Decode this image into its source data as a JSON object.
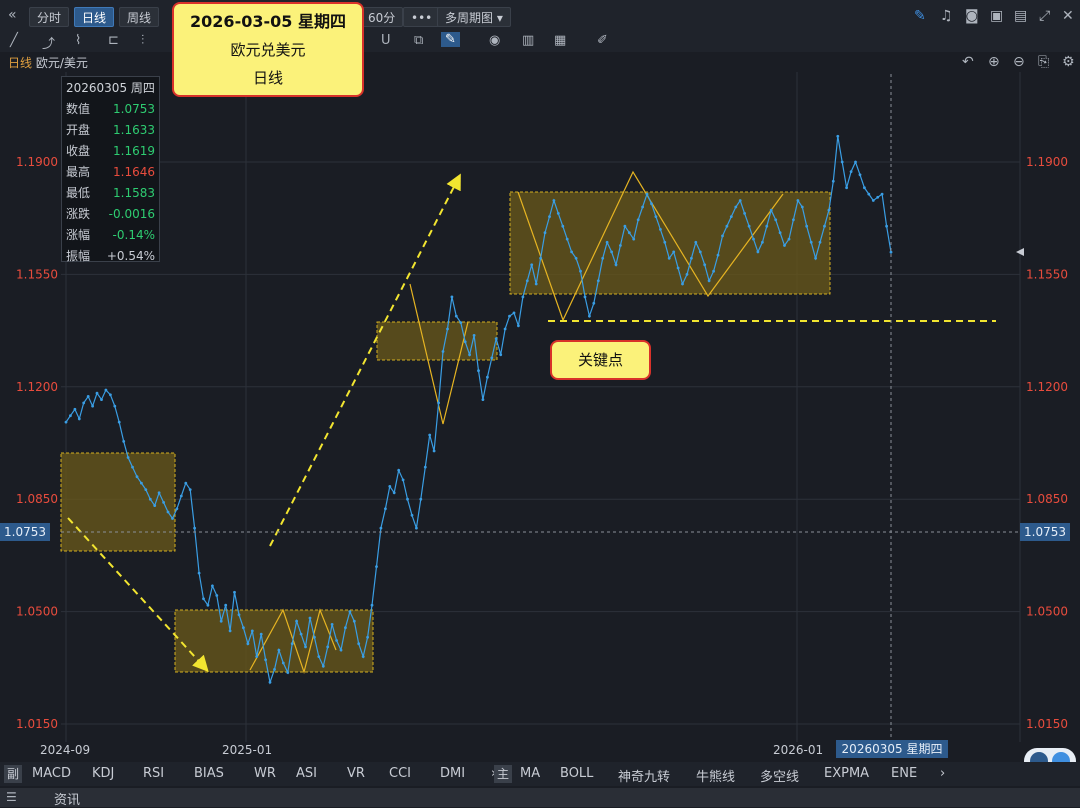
{
  "toolbar": {
    "nav_icon": "«",
    "buttons": [
      "分时",
      "日线",
      "周线"
    ],
    "active": "日线",
    "minute_button": "60分",
    "more_button": "•••",
    "multi_period": "多周期图 ▾"
  },
  "title": {
    "period": "日线",
    "instrument": "欧元/美元"
  },
  "callout_top": {
    "line1": "2026-03-05 星期四",
    "line2": "欧元兑美元",
    "line3": "日线"
  },
  "callout_key": "关键点",
  "info": {
    "header": "20260305 周四",
    "rows": [
      {
        "label": "数值",
        "value": "1.0753",
        "color": "#2ecc71"
      },
      {
        "label": "开盘",
        "value": "1.1633",
        "color": "#2ecc71"
      },
      {
        "label": "收盘",
        "value": "1.1619",
        "color": "#2ecc71"
      },
      {
        "label": "最高",
        "value": "1.1646",
        "color": "#e84c3d"
      },
      {
        "label": "最低",
        "value": "1.1583",
        "color": "#2ecc71"
      },
      {
        "label": "涨跌",
        "value": "-0.0016",
        "color": "#2ecc71"
      },
      {
        "label": "涨幅",
        "value": "-0.14%",
        "color": "#2ecc71"
      },
      {
        "label": "振幅",
        "value": "+0.54%",
        "color": "#c8ccd4"
      }
    ]
  },
  "current_price_tag": "1.0753",
  "date_tag": "20260305 星期四",
  "x_labels": [
    "2024-09",
    "2025-01",
    "2026-01"
  ],
  "bottom_indicators": [
    "副",
    "MACD",
    "KDJ",
    "RSI",
    "BIAS",
    "WR",
    "ASI",
    "VR",
    "CCI",
    "DMI",
    "›"
  ],
  "bottom_main": [
    "主",
    "MA",
    "BOLL",
    "神奇九转",
    "牛熊线",
    "多空线",
    "EXPMA",
    "ENE",
    "›"
  ],
  "info_bar": "资讯",
  "colors": {
    "line": "#3a9ee4",
    "box_fill": "#6b5a1a",
    "box_border": "#d4b020",
    "arrow": "#f2e530",
    "up": "#e84c3d",
    "down": "#2ecc71",
    "accent": "#2d5a8c"
  },
  "chart_data": {
    "type": "line",
    "title": "",
    "xlabel": "",
    "ylabel": "",
    "ylim": [
      1.015,
      1.205
    ],
    "y_ticks": [
      1.015,
      1.05,
      1.085,
      1.12,
      1.155,
      1.19
    ],
    "x_tick_labels": [
      "2024-09",
      "2025-01",
      "2026-01"
    ],
    "series": [
      {
        "values": [
          1.109,
          1.111,
          1.113,
          1.11,
          1.115,
          1.117,
          1.114,
          1.118,
          1.116,
          1.119,
          1.1175,
          1.114,
          1.109,
          1.103,
          1.098,
          1.095,
          1.092,
          1.09,
          1.088,
          1.085,
          1.083,
          1.087,
          1.084,
          1.081,
          1.079,
          1.082,
          1.086,
          1.09,
          1.088,
          1.076,
          1.062,
          1.054,
          1.052,
          1.058,
          1.055,
          1.047,
          1.052,
          1.044,
          1.056,
          1.049,
          1.045,
          1.04,
          1.044,
          1.036,
          1.043,
          1.035,
          1.028,
          1.032,
          1.038,
          1.034,
          1.031,
          1.04,
          1.047,
          1.043,
          1.039,
          1.048,
          1.042,
          1.036,
          1.033,
          1.039,
          1.046,
          1.041,
          1.038,
          1.045,
          1.05,
          1.047,
          1.04,
          1.036,
          1.042,
          1.052,
          1.064,
          1.076,
          1.082,
          1.089,
          1.087,
          1.094,
          1.091,
          1.085,
          1.08,
          1.076,
          1.085,
          1.095,
          1.105,
          1.1,
          1.115,
          1.131,
          1.138,
          1.148,
          1.142,
          1.14,
          1.134,
          1.13,
          1.136,
          1.125,
          1.116,
          1.123,
          1.129,
          1.135,
          1.13,
          1.138,
          1.142,
          1.143,
          1.139,
          1.148,
          1.153,
          1.158,
          1.152,
          1.16,
          1.168,
          1.173,
          1.178,
          1.174,
          1.17,
          1.166,
          1.162,
          1.16,
          1.156,
          1.148,
          1.142,
          1.146,
          1.153,
          1.16,
          1.165,
          1.162,
          1.158,
          1.164,
          1.17,
          1.168,
          1.166,
          1.172,
          1.176,
          1.18,
          1.177,
          1.173,
          1.169,
          1.165,
          1.16,
          1.162,
          1.157,
          1.152,
          1.155,
          1.16,
          1.165,
          1.162,
          1.158,
          1.153,
          1.156,
          1.161,
          1.167,
          1.17,
          1.173,
          1.176,
          1.178,
          1.174,
          1.17,
          1.166,
          1.162,
          1.165,
          1.17,
          1.175,
          1.172,
          1.168,
          1.164,
          1.166,
          1.172,
          1.178,
          1.176,
          1.17,
          1.165,
          1.16,
          1.165,
          1.17,
          1.175,
          1.184,
          1.198,
          1.19,
          1.182,
          1.187,
          1.19,
          1.186,
          1.182,
          1.18,
          1.178,
          1.179,
          1.18,
          1.17,
          1.1619
        ]
      }
    ]
  }
}
